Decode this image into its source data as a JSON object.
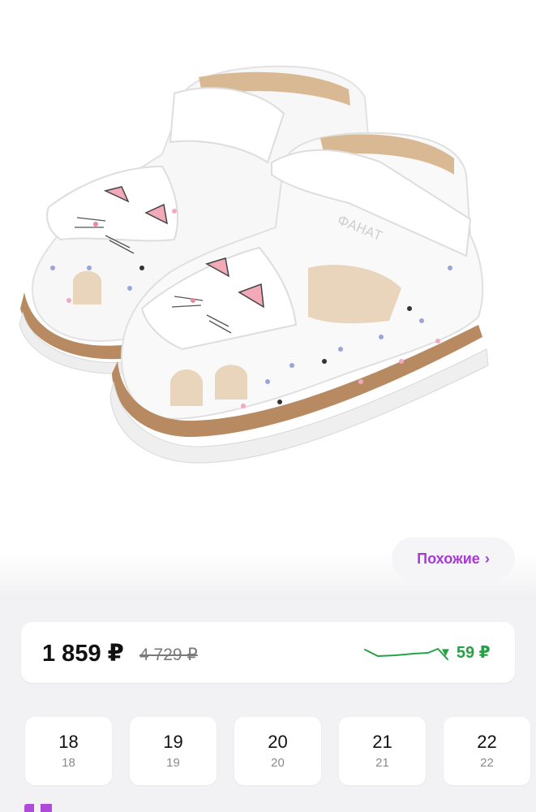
{
  "product": {
    "image_icon": "sandal-product-photo",
    "similar_label": "Похожие",
    "similar_chevron": "›"
  },
  "price": {
    "current": "1 859 ₽",
    "old": "4 729 ₽",
    "drop_arrow": "▼",
    "drop_amount": "59 ₽",
    "trend_icon": "price-trend-sparkline",
    "accent_color": "#a73ad6",
    "drop_color": "#25a244"
  },
  "sizes": [
    {
      "label": "18",
      "sub": "18"
    },
    {
      "label": "19",
      "sub": "19"
    },
    {
      "label": "20",
      "sub": "20"
    },
    {
      "label": "21",
      "sub": "21"
    },
    {
      "label": "22",
      "sub": "22"
    }
  ]
}
